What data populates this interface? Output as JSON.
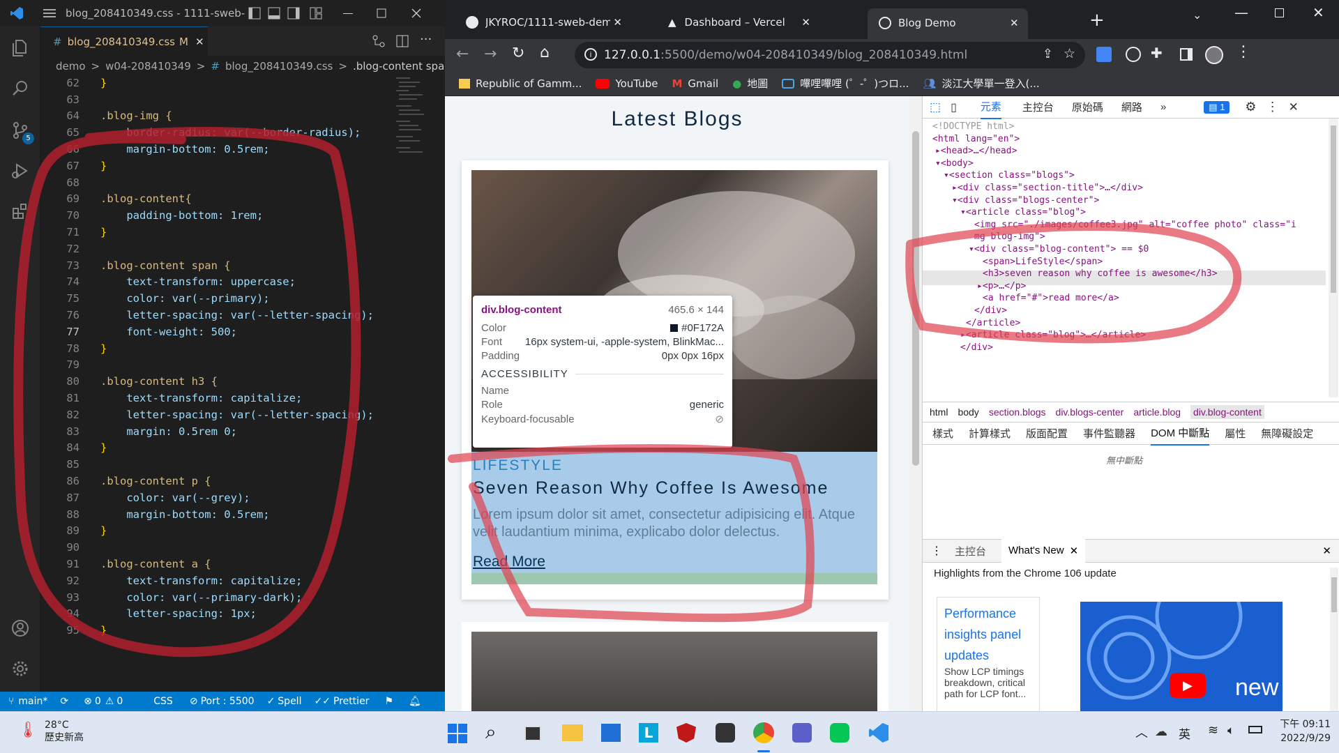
{
  "vscode": {
    "title": "blog_208410349.css - 1111-sweb-de...",
    "tab_label": "blog_208410349.css",
    "tab_modified": "M",
    "breadcrumb": [
      "demo",
      ">",
      "w04-208410349",
      ">",
      "#",
      "blog_208410349.css",
      ">",
      ".blog-content span"
    ],
    "scm_badge": "5",
    "lines": [
      {
        "n": "62",
        "t": "}"
      },
      {
        "n": "63",
        "t": ""
      },
      {
        "n": "64",
        "t": ".blog-img {"
      },
      {
        "n": "65",
        "t": "    border-radius: var(--border-radius);"
      },
      {
        "n": "66",
        "t": "    margin-bottom: 0.5rem;"
      },
      {
        "n": "67",
        "t": "}"
      },
      {
        "n": "68",
        "t": ""
      },
      {
        "n": "69",
        "t": ".blog-content{"
      },
      {
        "n": "70",
        "t": "    padding-bottom: 1rem;"
      },
      {
        "n": "71",
        "t": "}"
      },
      {
        "n": "72",
        "t": ""
      },
      {
        "n": "73",
        "t": ".blog-content span {"
      },
      {
        "n": "74",
        "t": "    text-transform: uppercase;"
      },
      {
        "n": "75",
        "t": "    color: var(--primary);"
      },
      {
        "n": "76",
        "t": "    letter-spacing: var(--letter-spacing);"
      },
      {
        "n": "77",
        "t": "    font-weight: 500;"
      },
      {
        "n": "78",
        "t": "}"
      },
      {
        "n": "79",
        "t": ""
      },
      {
        "n": "80",
        "t": ".blog-content h3 {"
      },
      {
        "n": "81",
        "t": "    text-transform: capitalize;"
      },
      {
        "n": "82",
        "t": "    letter-spacing: var(--letter-spacing);"
      },
      {
        "n": "83",
        "t": "    margin: 0.5rem 0;"
      },
      {
        "n": "84",
        "t": "}"
      },
      {
        "n": "85",
        "t": ""
      },
      {
        "n": "86",
        "t": ".blog-content p {"
      },
      {
        "n": "87",
        "t": "    color: var(--grey);"
      },
      {
        "n": "88",
        "t": "    margin-bottom: 0.5rem;"
      },
      {
        "n": "89",
        "t": "}"
      },
      {
        "n": "90",
        "t": ""
      },
      {
        "n": "91",
        "t": ".blog-content a {"
      },
      {
        "n": "92",
        "t": "    text-transform: capitalize;"
      },
      {
        "n": "93",
        "t": "    color: var(--primary-dark);"
      },
      {
        "n": "94",
        "t": "    letter-spacing: 1px;"
      },
      {
        "n": "95",
        "t": "}"
      }
    ],
    "status": {
      "branch": "main*",
      "errors": "0",
      "warnings": "0",
      "language": "CSS",
      "port": "Port : 5500",
      "spell": "Spell",
      "prettier": "Prettier"
    }
  },
  "chrome": {
    "tabs": [
      {
        "label": "JKYROC/1111-sweb-demo-208"
      },
      {
        "label": "Dashboard – Vercel"
      },
      {
        "label": "Blog Demo"
      }
    ],
    "url_host": "127.0.0.1",
    "url_path": ":5500/demo/w04-208410349/blog_208410349.html",
    "bookmarks": [
      "Republic of Gamm...",
      "YouTube",
      "Gmail",
      "地圖",
      "嗶哩嗶哩 (゜-゜)つロ...",
      "淡江大學單一登入(..."
    ]
  },
  "page": {
    "title": "Latest Blogs",
    "blog": {
      "category": "LifeStyle",
      "heading": "Seven Reason Why Coffee Is Awesome",
      "body": "Lorem ipsum dolor sit amet, consectetur adipisicing elit. Atque velit laudantium minima, explicabo dolor delectus.",
      "link": "Read More"
    },
    "tooltip": {
      "selector": "div.blog-content",
      "size": "465.6 × 144",
      "color_label": "Color",
      "color_value": "#0F172A",
      "font_label": "Font",
      "font_value": "16px system-ui, -apple-system, BlinkMac...",
      "padding_label": "Padding",
      "padding_value": "0px 0px 16px",
      "a11y_header": "ACCESSIBILITY",
      "name_label": "Name",
      "role_label": "Role",
      "role_value": "generic",
      "kbd_label": "Keyboard-focusable"
    }
  },
  "devtools": {
    "tabs": [
      "元素",
      "主控台",
      "原始碼",
      "網路",
      "»"
    ],
    "issues_count": "1",
    "dom": [
      "<!DOCTYPE html>",
      "<html lang=\"en\">",
      "▸<head>…</head>",
      "▾<body>",
      "▾<section class=\"blogs\">",
      "▸<div class=\"section-title\">…</div>",
      "▾<div class=\"blogs-center\">",
      "▾<article class=\"blog\">",
      "<img src=\"./images/coffee3.jpg\" alt=\"coffee photo\" class=\"i",
      "mg blog-img\">",
      "▾<div class=\"blog-content\"> == $0",
      "<span>LifeStyle</span>",
      "<h3>seven reason why coffee is awesome</h3>",
      "▸<p>…</p>",
      "<a href=\"#\">read more</a>",
      "</div>",
      "</article>",
      "▸<article class=\"blog\">…</article>",
      "</div>"
    ],
    "breadcrumbs": [
      "html",
      "body",
      "section.blogs",
      "div.blogs-center",
      "article.blog",
      "div.blog-content"
    ],
    "subtabs": [
      "樣式",
      "計算樣式",
      "版面配置",
      "事件監聽器",
      "DOM 中斷點",
      "屬性",
      "無障礙設定"
    ],
    "no_breakpoints": "無中斷點",
    "drawer": {
      "tabs": [
        "主控台",
        "What's New"
      ],
      "headline": "Highlights from the Chrome 106 update",
      "link": "Performance insights panel updates",
      "desc": "Show LCP timings breakdown, critical path for LCP font...",
      "video_text": "new"
    }
  },
  "taskbar": {
    "temp": "28°C",
    "weather": "歷史新高",
    "ime": "英",
    "time": "下午 09:11",
    "date": "2022/9/29"
  },
  "colors": {
    "accent": "#007acc",
    "scribble": "#e0424f",
    "highlight": "#6fa8dc"
  }
}
